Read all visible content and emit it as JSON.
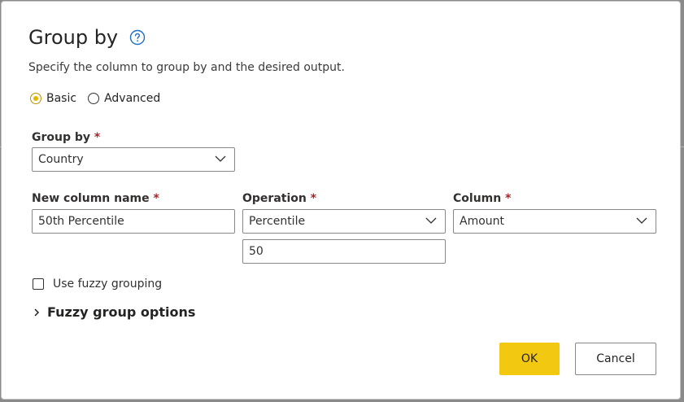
{
  "dialog": {
    "title": "Group by",
    "help_icon": "help-circle-icon",
    "subtitle": "Specify the column to group by and the desired output."
  },
  "mode": {
    "options": [
      {
        "label": "Basic",
        "checked": true
      },
      {
        "label": "Advanced",
        "checked": false
      }
    ]
  },
  "group_by": {
    "label": "Group by",
    "required_mark": "*",
    "value": "Country"
  },
  "aggregation": {
    "new_column": {
      "label": "New column name",
      "required_mark": "*",
      "value": "50th Percentile"
    },
    "operation": {
      "label": "Operation",
      "required_mark": "*",
      "value": "Percentile",
      "parameter": "50"
    },
    "column": {
      "label": "Column",
      "required_mark": "*",
      "value": "Amount"
    }
  },
  "fuzzy": {
    "checkbox_label": "Use fuzzy grouping",
    "checked": false,
    "options_label": "Fuzzy group options"
  },
  "buttons": {
    "ok": "OK",
    "cancel": "Cancel"
  },
  "colors": {
    "accent": "#f2c811",
    "help_icon": "#1f6fc5",
    "required": "#a4262c"
  }
}
